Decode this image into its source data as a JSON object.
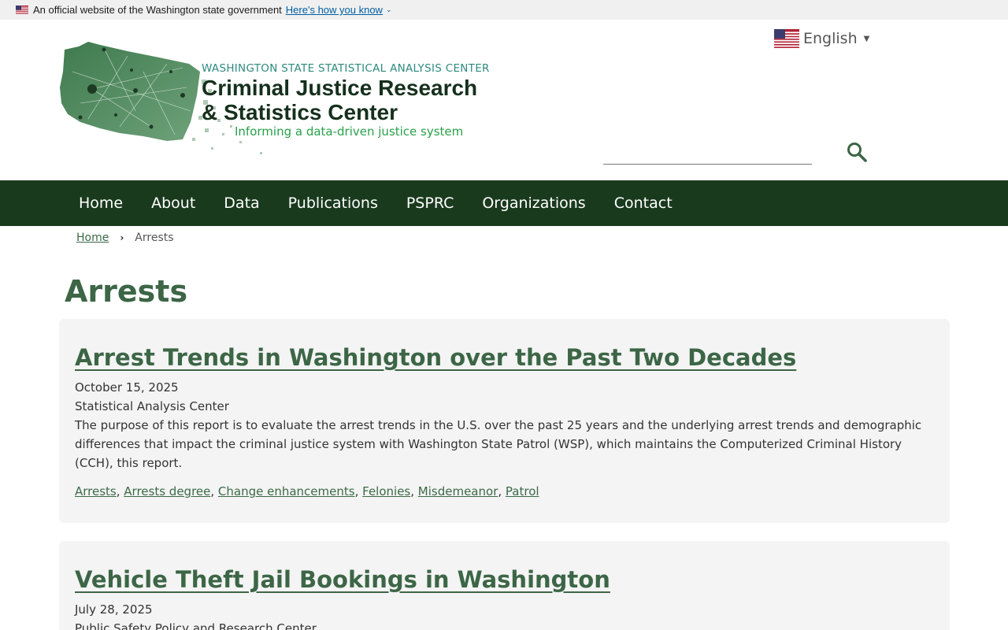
{
  "banner": {
    "text": "An official website of the Washington state government",
    "link": "Here's how you know"
  },
  "logo": {
    "line1": "WASHINGTON STATE STATISTICAL ANALYSIS CENTER",
    "line2": "Criminal Justice Research",
    "line3": "& Statistics Center",
    "tagline": "Informing a data-driven justice system"
  },
  "language": {
    "selected": "English"
  },
  "search": {
    "value": "",
    "placeholder": ""
  },
  "nav": {
    "items": [
      "Home",
      "About",
      "Data",
      "Publications",
      "PSPRC",
      "Organizations",
      "Contact"
    ]
  },
  "breadcrumb": {
    "home": "Home",
    "current": "Arrests"
  },
  "page": {
    "title": "Arrests"
  },
  "cards": [
    {
      "title": "Arrest Trends in Washington over the Past Two Decades",
      "date": "October 15, 2025",
      "org": "Statistical Analysis Center",
      "desc": "The purpose of this report is to evaluate the arrest trends in the U.S. over the past 25 years and the underlying arrest trends and demographic differences that impact the criminal justice system with Washington State Patrol (WSP), which maintains the Computerized Criminal History (CCH), this report.",
      "tags": [
        "Arrests",
        "Arrests degree",
        "Change enhancements",
        "Felonies",
        "Misdemeanor",
        "Patrol"
      ]
    },
    {
      "title": "Vehicle Theft Jail Bookings in Washington",
      "date": "July 28, 2025",
      "org": "Public Safety Policy and Research Center"
    }
  ],
  "colors": {
    "nav_bg": "#1a3a1e",
    "title_green": "#3c6646",
    "card_bg": "#f4f4f4"
  },
  "icons": {
    "search": "search-icon",
    "flag": "us-flag-icon",
    "caret": "caret-down-icon"
  }
}
